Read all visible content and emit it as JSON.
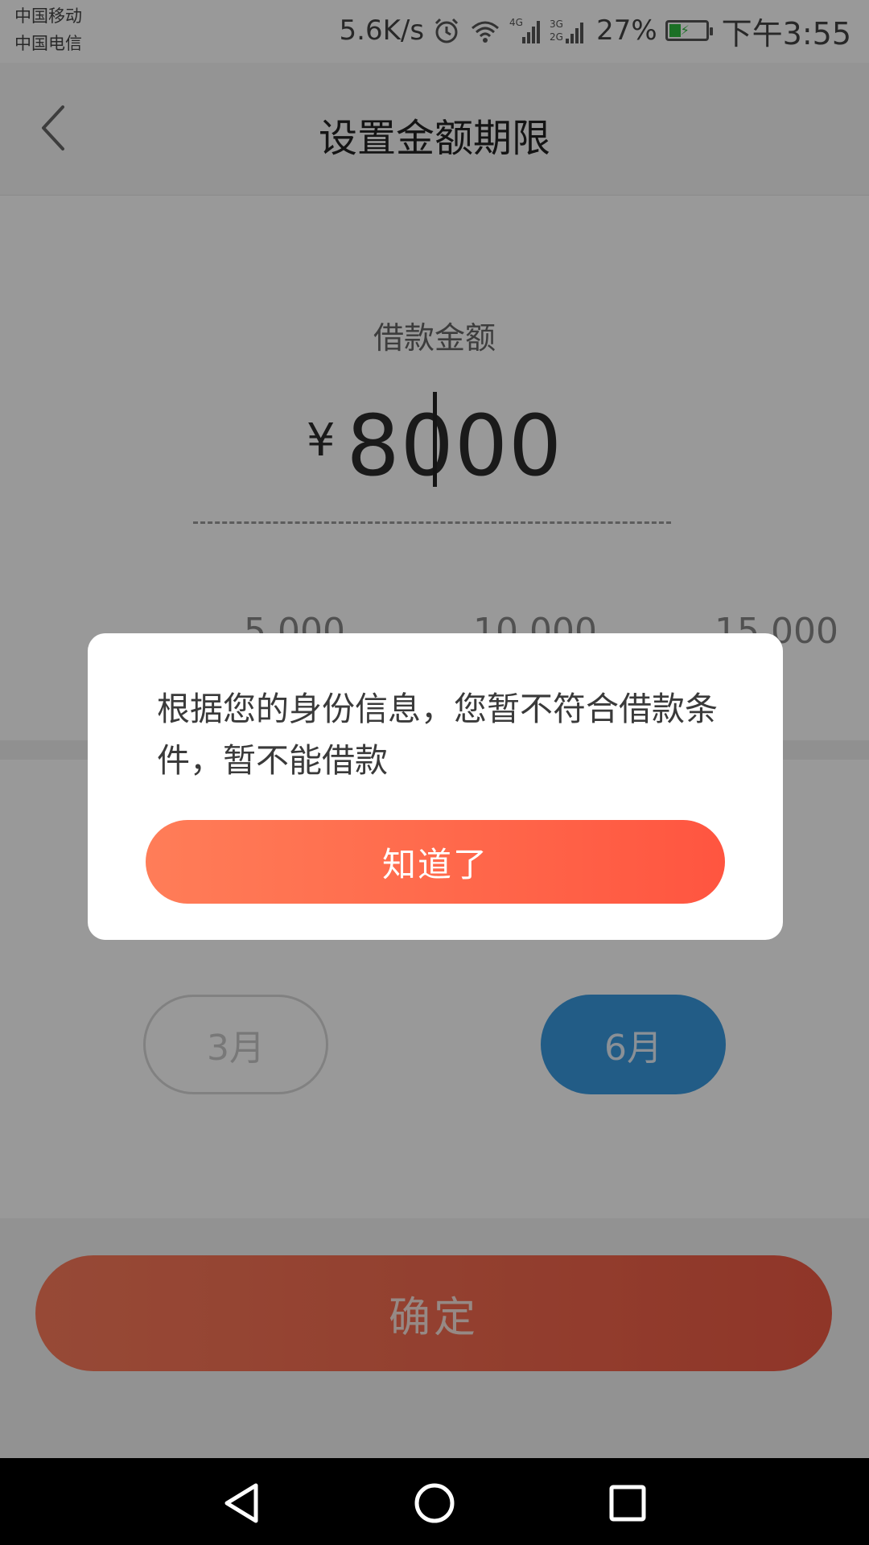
{
  "status_bar": {
    "carrier_1": "中国移动",
    "carrier_2": "中国电信",
    "net_speed": "5.6K/s",
    "network_1": "4G",
    "network_2a": "3G",
    "network_2b": "2G",
    "battery_percent": "27%",
    "time": "下午3:55",
    "icons": [
      "alarm-icon",
      "wifi-icon",
      "signal-4g-icon",
      "signal-3g2g-icon",
      "battery-charging-icon"
    ]
  },
  "header": {
    "title": "设置金额期限"
  },
  "amount": {
    "label": "借款金额",
    "currency_symbol": "¥",
    "value": "8000",
    "ticks": [
      "5,000",
      "10,000",
      "15,000"
    ]
  },
  "term": {
    "options": [
      "3月",
      "6月"
    ],
    "selected": "6月"
  },
  "confirm_label": "确定",
  "dialog": {
    "message": "根据您的身份信息，您暂不符合借款条件，暂不能借款",
    "button_label": "知道了"
  },
  "colors": {
    "accent_orange": "#ff6a4c",
    "selected_blue": "#3a9ae0",
    "battery_green": "#2dbb3f"
  }
}
